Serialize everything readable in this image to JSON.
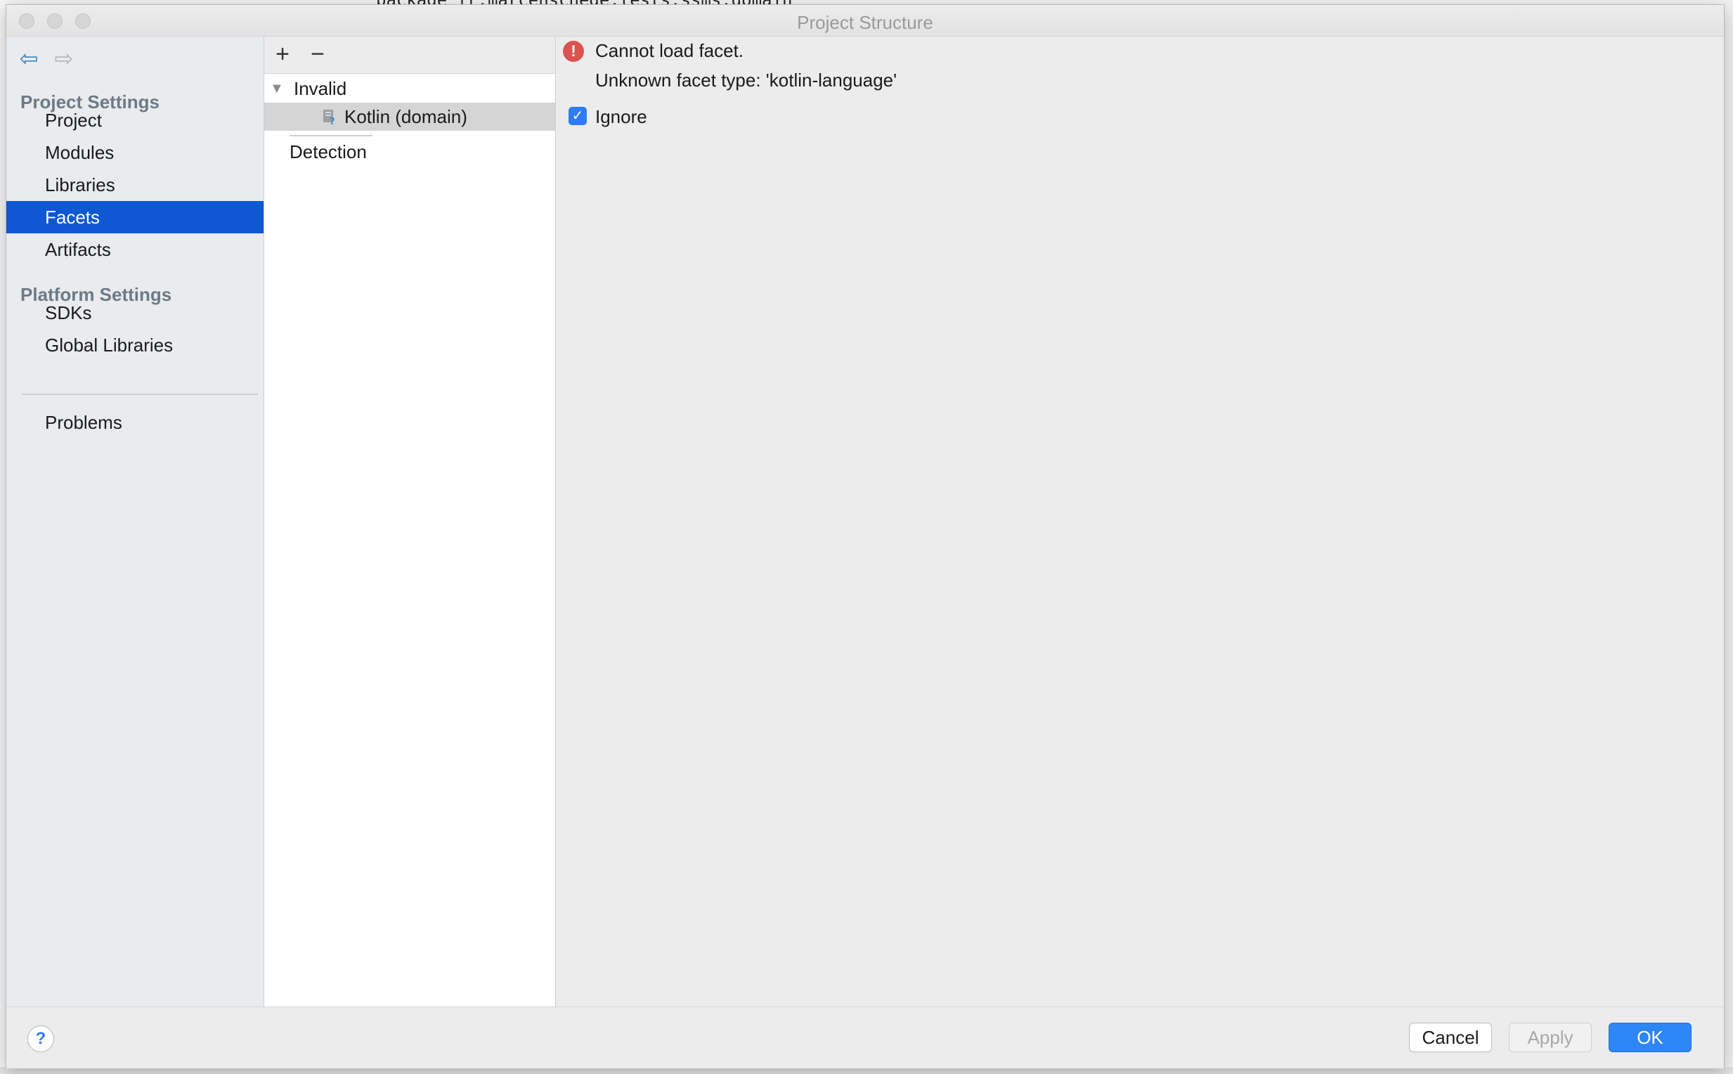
{
  "window": {
    "title": "Project Structure",
    "background_code": "package fr.marcenschede.tests.ssms.domain"
  },
  "sidebar": {
    "sections": [
      {
        "header": "Project Settings",
        "items": [
          "Project",
          "Modules",
          "Libraries",
          "Facets",
          "Artifacts"
        ]
      },
      {
        "header": "Platform Settings",
        "items": [
          "SDKs",
          "Global Libraries"
        ]
      }
    ],
    "problems_label": "Problems",
    "selected": "Facets"
  },
  "tree": {
    "toolbar": {
      "add": "+",
      "remove": "−"
    },
    "group_label": "Invalid",
    "selected_item": "Kotlin (domain)",
    "detection_label": "Detection"
  },
  "detail": {
    "error_title": "Cannot load facet.",
    "error_detail": "Unknown facet type: 'kotlin-language'",
    "ignore_label": "Ignore",
    "ignore_checked": true
  },
  "footer": {
    "help": "?",
    "cancel": "Cancel",
    "apply": "Apply",
    "ok": "OK"
  },
  "colors": {
    "selection_blue": "#0f57d3",
    "ok_blue": "#2f86f6",
    "error_red": "#d9534f",
    "section_header": "#6d7a86"
  }
}
